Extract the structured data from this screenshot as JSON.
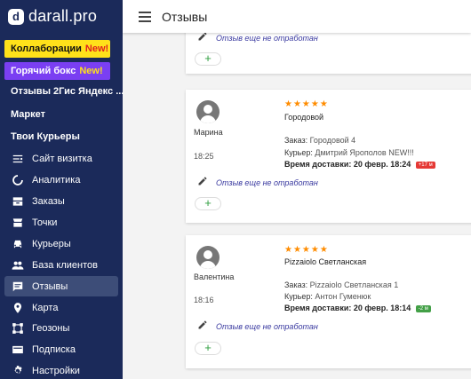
{
  "brand": {
    "mark": "d",
    "name": "darall.pro"
  },
  "promos": [
    {
      "label": "Коллаборации",
      "badge": "New!"
    },
    {
      "label": "Горячий бокс",
      "badge": "New!"
    }
  ],
  "sidebar": {
    "headers": [
      "Отзывы 2Гис Яндекс ...",
      "Маркет",
      "Твои Курьеры"
    ],
    "items": [
      {
        "label": "Сайт визитка",
        "icon": "site-icon"
      },
      {
        "label": "Аналитика",
        "icon": "analytics-icon"
      },
      {
        "label": "Заказы",
        "icon": "orders-icon"
      },
      {
        "label": "Точки",
        "icon": "location-icon"
      },
      {
        "label": "Курьеры",
        "icon": "courier-icon"
      },
      {
        "label": "База клиентов",
        "icon": "clients-icon"
      },
      {
        "label": "Отзывы",
        "icon": "reviews-icon",
        "active": true
      },
      {
        "label": "Карта",
        "icon": "map-icon"
      },
      {
        "label": "Геозоны",
        "icon": "geozone-icon"
      },
      {
        "label": "Подписка",
        "icon": "subscription-icon"
      },
      {
        "label": "Настройки",
        "icon": "settings-icon"
      }
    ]
  },
  "header": {
    "title": "Отзывы"
  },
  "reviews": [
    {
      "edit_text": "Отзыв еще не отработан",
      "add_label": "+"
    },
    {
      "name": "Марина",
      "time": "18:25",
      "stars": "★★★★★",
      "restaurant": "Городовой",
      "order_label": "Заказ:",
      "order_value": "Городовой 4",
      "courier_label": "Курьер:",
      "courier_value": "Дмитрий Ярополов NEW!!!",
      "delivery_label": "Время доставки:",
      "delivery_value": "20 февр. 18:24",
      "badge": "+17 м",
      "badge_color": "#e53935",
      "edit_text": "Отзыв еще не отработан",
      "add_label": "+"
    },
    {
      "name": "Валентина",
      "time": "18:16",
      "stars": "★★★★★",
      "restaurant": "Pizzaiolo Светланская",
      "order_label": "Заказ:",
      "order_value": "Pizzaiolo Светланская 1",
      "courier_label": "Курьер:",
      "courier_value": "Антон Гуменюк",
      "delivery_label": "Время доставки:",
      "delivery_value": "20 февр. 18:14",
      "badge": "-2 м",
      "badge_color": "#43a047",
      "edit_text": "Отзыв еще не отработан",
      "add_label": "+"
    }
  ]
}
